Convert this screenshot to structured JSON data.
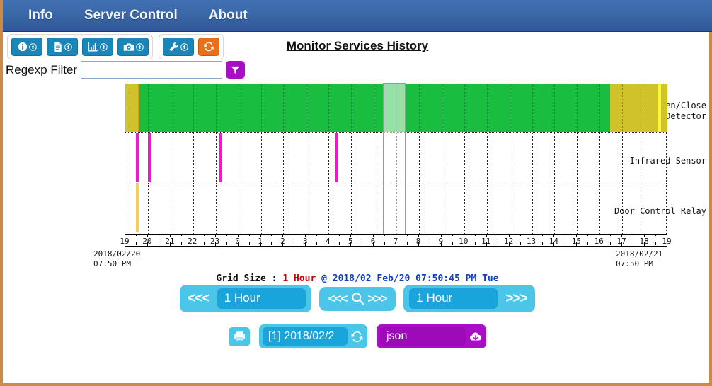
{
  "navbar": {
    "items": [
      {
        "label": "Info",
        "name": "nav-item-info"
      },
      {
        "label": "Server Control",
        "name": "nav-item-server-control"
      },
      {
        "label": "About",
        "name": "nav-item-about"
      }
    ]
  },
  "toolbar": {
    "groups": [
      {
        "buttons": [
          {
            "icon": "info-icon",
            "badge": "up-arrow-circle-icon",
            "color": "#1a86b8"
          },
          {
            "icon": "document-icon",
            "badge": "up-arrow-circle-icon",
            "color": "#1a86b8"
          },
          {
            "icon": "bar-chart-icon",
            "badge": "up-arrow-circle-icon",
            "color": "#1a86b8"
          },
          {
            "icon": "camera-icon",
            "badge": "up-arrow-circle-icon",
            "color": "#1a86b8"
          }
        ]
      },
      {
        "buttons": [
          {
            "icon": "wrench-icon",
            "badge": "up-arrow-circle-icon",
            "color": "#1a86b8"
          },
          {
            "icon": "refresh-icon",
            "badge": "",
            "color": "#e8701a"
          }
        ]
      }
    ]
  },
  "header": {
    "title": "Monitor Services History"
  },
  "filter": {
    "label": "Regexp Filter",
    "value": "",
    "placeholder": "",
    "button_icon": "funnel-filter-icon"
  },
  "chart_data": {
    "type": "timeline",
    "title": "Monitor Services History",
    "xlabel": "",
    "ylabel": "",
    "grid": true,
    "legend_position": "none",
    "x_start_label": "2018/02/20\n07:50 PM",
    "x_end_label": "2018/02/21\n07:50 PM",
    "x_ticks": [
      "19",
      "20",
      "21",
      "22",
      "23",
      "0",
      "1",
      "2",
      "3",
      "4",
      "5",
      "6",
      "7",
      "8",
      "9",
      "10",
      "11",
      "12",
      "13",
      "14",
      "15",
      "16",
      "17",
      "18",
      "19"
    ],
    "xlim_hours": [
      0,
      24
    ],
    "minor_ticks_per_hour": 2,
    "lanes": [
      {
        "label": "Door Open/Close\nDetector",
        "name": "lane-door-open-close-detector",
        "render": "band",
        "segments": [
          {
            "start_h": 0.0,
            "end_h": 0.57,
            "color": "#cfc22a",
            "state": "unknown"
          },
          {
            "start_h": 0.57,
            "end_h": 0.62,
            "color": "#ef8a1c",
            "state": "warning"
          },
          {
            "start_h": 0.62,
            "end_h": 21.45,
            "color": "#19bd3f",
            "state": "ok"
          },
          {
            "start_h": 21.45,
            "end_h": 23.6,
            "color": "#cfc22a",
            "state": "unknown"
          },
          {
            "start_h": 23.6,
            "end_h": 23.72,
            "color": "#fdf834",
            "state": "alert"
          },
          {
            "start_h": 23.72,
            "end_h": 23.98,
            "color": "#cfc22a",
            "state": "unknown"
          },
          {
            "start_h": 23.98,
            "end_h": 24.0,
            "color": "#fdf834",
            "state": "alert"
          }
        ]
      },
      {
        "label": "Infrared Sensor",
        "name": "lane-infrared-sensor",
        "render": "ticks",
        "tick_color": "#f812d2",
        "ticks_h": [
          0.54,
          1.07,
          4.23,
          9.36
        ]
      },
      {
        "label": "Door Control Relay",
        "name": "lane-door-control-relay",
        "render": "ticks",
        "tick_color": "#f9cf52",
        "ticks_h": [
          0.54
        ]
      }
    ],
    "selection": {
      "start_h": 11.44,
      "end_h": 12.47,
      "label": "selected-hour"
    }
  },
  "grid_size": {
    "prefix": "Grid Size : ",
    "value": "1 Hour",
    "suffix": " @ 2018/02 Feb/20 07:50:45 PM Tue"
  },
  "navigation": {
    "prev_arrow": "<<<",
    "prev_span": "1 Hour",
    "zoom_label_left": "<<<",
    "zoom_icon": "magnifier-icon",
    "zoom_label_right": ">>>",
    "next_span": "1 Hour",
    "next_arrow": ">>>"
  },
  "bottom": {
    "print_icon": "printer-icon",
    "date_value": "[1] 2018/02/2",
    "date_refresh_icon": "refresh-icon",
    "export_value": "json",
    "export_icon": "download-cloud-icon"
  },
  "colors": {
    "navbar": "#3b68a8",
    "accent_blue": "#19a5dc",
    "accent_light_blue": "#4cc6e8",
    "purple": "#a80ec4",
    "orange": "#e8701a",
    "green": "#19bd3f",
    "olive": "#cfc22a",
    "yellow": "#fdf834",
    "magenta": "#f812d2",
    "page_border": "#c98b45"
  }
}
